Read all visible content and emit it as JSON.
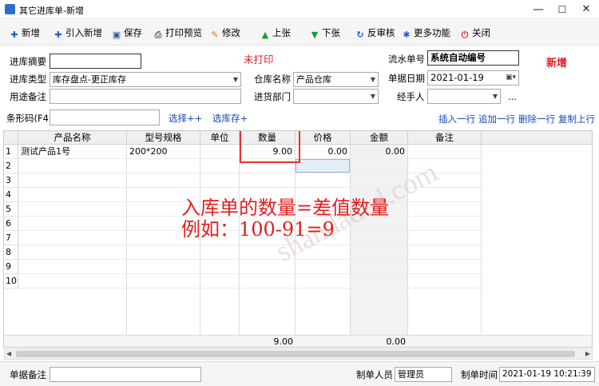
{
  "window": {
    "title": "其它进库单-新增",
    "min": "—",
    "max": "☐",
    "close": "✕"
  },
  "toolbar": [
    {
      "label": "新增",
      "icon": "plus-icon",
      "color": "#1f5fd0",
      "glyph": "✚"
    },
    {
      "label": "引入新增",
      "icon": "plus-icon",
      "color": "#1f5fd0",
      "glyph": "✚"
    },
    {
      "label": "保存",
      "icon": "save-icon",
      "color": "#2c5aa0",
      "glyph": "▣"
    },
    {
      "label": "打印预览",
      "icon": "printer-icon",
      "color": "#666666",
      "glyph": "⎙"
    },
    {
      "label": "修改",
      "icon": "edit-icon",
      "color": "#c08020",
      "glyph": "✎"
    },
    {
      "label": "上张",
      "icon": "arrow-up-icon",
      "color": "#1a9a3a",
      "glyph": "▲"
    },
    {
      "label": "下张",
      "icon": "arrow-down-icon",
      "color": "#1a9a3a",
      "glyph": "▼"
    },
    {
      "label": "反审核",
      "icon": "undo-icon",
      "color": "#1f5fd0",
      "glyph": "↻"
    },
    {
      "label": "更多功能",
      "icon": "gear-icon",
      "color": "#1f5fd0",
      "glyph": "✱"
    },
    {
      "label": "关闭",
      "icon": "close-icon",
      "color": "#e03030",
      "glyph": "⏻"
    }
  ],
  "form": {
    "summary_label": "进库摘要",
    "summary_value": "",
    "print_status": "未打印",
    "serial_label": "流水单号",
    "serial_value": "系统自动编号",
    "mode_badge": "新增",
    "type_label": "进库类型",
    "type_value": "库存盘点-更正库存",
    "warehouse_label": "仓库名称",
    "warehouse_value": "产品仓库",
    "date_label": "单据日期",
    "date_value": "2021-01-19",
    "purpose_label": "用途备注",
    "purpose_value": "",
    "dept_label": "进货部门",
    "dept_value": "",
    "handler_label": "经手人",
    "handler_value": "",
    "handler_more": "..."
  },
  "barcode": {
    "label": "条形码(F4)",
    "value": "",
    "select_plus": "选择++",
    "select_stock": "选库存+"
  },
  "row_actions": [
    "插入一行",
    "追加一行",
    "删除一行",
    "复制上行"
  ],
  "table": {
    "columns": [
      "产品名称",
      "型号规格",
      "单位",
      "数量",
      "价格",
      "金额",
      "备注"
    ],
    "rows": [
      {
        "no": "1",
        "name": "测试产品1号",
        "spec": "200*200",
        "unit": "",
        "qty": "9.00",
        "price": "0.00",
        "amount": "0.00",
        "note": ""
      },
      {
        "no": "2"
      },
      {
        "no": "3"
      },
      {
        "no": "4"
      },
      {
        "no": "5"
      },
      {
        "no": "6"
      },
      {
        "no": "7"
      },
      {
        "no": "8"
      },
      {
        "no": "9"
      },
      {
        "no": "10"
      }
    ],
    "total_qty": "9.00",
    "total_amount": "0.00"
  },
  "annotation": {
    "line1": "入库单的数量=差值数量",
    "line2": "例如：100-91=9"
  },
  "watermark": "shandaded.com",
  "footer": {
    "note_label": "单据备注",
    "note_value": "",
    "maker_label": "制单人员",
    "maker_value": "管理员",
    "time_label": "制单时间",
    "time_value": "2021-01-19 10:21:39"
  }
}
